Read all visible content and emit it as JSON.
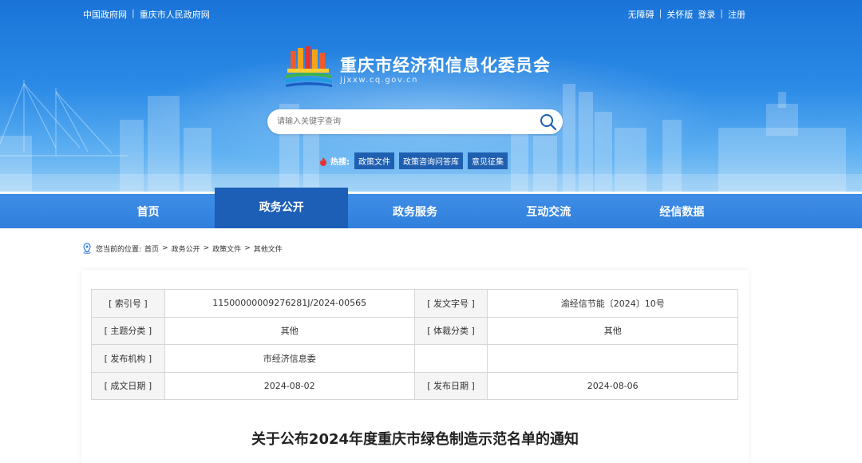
{
  "topbar": {
    "left_links": [
      "中国政府网",
      "重庆市人民政府网"
    ],
    "right_links": [
      "无障碍",
      "关怀版",
      "登录",
      "注册"
    ]
  },
  "site": {
    "title": "重庆市经济和信息化委员会",
    "domain": "jjxxw.cq.gov.cn"
  },
  "search": {
    "placeholder": "请输入关键字查询"
  },
  "hot": {
    "label": "热搜:",
    "tags": [
      "政策文件",
      "政策咨询问答库",
      "意见征集"
    ]
  },
  "nav": {
    "items": [
      "首页",
      "政务公开",
      "政务服务",
      "互动交流",
      "经信数据"
    ],
    "active_index": 1
  },
  "breadcrumb": {
    "prefix": "您当前的位置:",
    "path": [
      "首页",
      "政务公开",
      "政策文件",
      "其他文件"
    ]
  },
  "meta": {
    "rows": [
      {
        "k1": "[ 索引号 ]",
        "v1": "11500000009276281J/2024-00565",
        "k2": "[ 发文字号 ]",
        "v2": "渝经信节能〔2024〕10号"
      },
      {
        "k1": "[ 主题分类 ]",
        "v1": "其他",
        "k2": "[ 体裁分类 ]",
        "v2": "其他"
      },
      {
        "k1": "[ 发布机构 ]",
        "v1": "市经济信息委",
        "k2": "",
        "v2": ""
      },
      {
        "k1": "[ 成文日期 ]",
        "v1": "2024-08-02",
        "k2": "[ 发布日期 ]",
        "v2": "2024-08-06"
      }
    ]
  },
  "document": {
    "title": "关于公布2024年度重庆市绿色制造示范名单的通知"
  },
  "colors": {
    "banner_top": "#1a74d8",
    "nav": "#2f7fdc",
    "nav_active": "#1d5fb6",
    "hot_tag": "#1f5fb0"
  }
}
